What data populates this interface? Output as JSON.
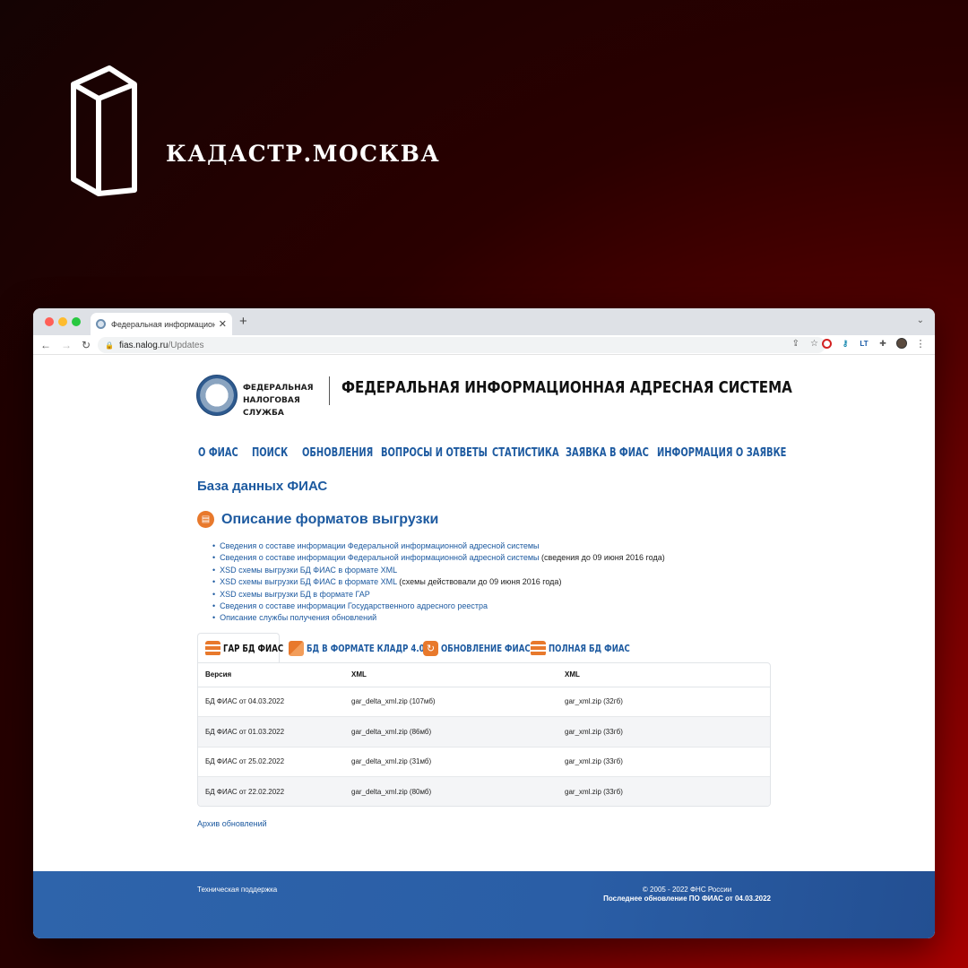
{
  "brand": {
    "name": "КАДАСТР.МОСКВА"
  },
  "browser": {
    "tab_title": "Федеральная информационн",
    "url_host": "fias.nalog.ru",
    "url_path": "/Updates"
  },
  "site": {
    "org_name": "ФЕДЕРАЛЬНАЯ НАЛОГОВАЯ СЛУЖБА",
    "title": "ФЕДЕРАЛЬНАЯ ИНФОРМАЦИОННАЯ АДРЕСНАЯ СИСТЕМА",
    "nav": [
      "О ФИАС",
      "ПОИСК",
      "ОБНОВЛЕНИЯ",
      "ВОПРОСЫ И ОТВЕТЫ",
      "СТАТИСТИКА",
      "ЗАЯВКА В ФИАС",
      "ИНФОРМАЦИЯ О ЗАЯВКЕ"
    ],
    "db_title": "База данных ФИАС",
    "section_title": "Описание форматов выгрузки",
    "links": [
      {
        "text": "Сведения о составе информации Федеральной информационной адресной системы",
        "note": ""
      },
      {
        "text": "Сведения о составе информации Федеральной информационной адресной системы",
        "note": " (сведения до 09 июня 2016 года)"
      },
      {
        "text": "XSD схемы выгрузки БД ФИАС в формате XML",
        "note": ""
      },
      {
        "text": "XSD схемы выгрузки БД ФИАС в формате XML",
        "note": " (схемы действовали до 09 июня 2016 года)"
      },
      {
        "text": "XSD схемы выгрузки БД в формате ГАР",
        "note": ""
      },
      {
        "text": "Сведения о составе информации Государственного адресного реестра",
        "note": ""
      },
      {
        "text": "Описание службы получения обновлений",
        "note": ""
      }
    ],
    "file_tabs": [
      {
        "label": "ГАР БД ФИАС",
        "icon": "server-stack-icon"
      },
      {
        "label": "БД В ФОРМАТЕ КЛАДР 4.0",
        "icon": "layers-icon"
      },
      {
        "label": "ОБНОВЛЕНИЕ ФИАС",
        "icon": "refresh-icon"
      },
      {
        "label": "ПОЛНАЯ БД ФИАС",
        "icon": "server-stack-icon"
      }
    ],
    "table": {
      "headers": [
        "Версия",
        "XML",
        "XML"
      ],
      "rows": [
        [
          "БД ФИАС от 04.03.2022",
          "gar_delta_xml.zip (107мб)",
          "gar_xml.zip (32гб)"
        ],
        [
          "БД ФИАС от 01.03.2022",
          "gar_delta_xml.zip (86мб)",
          "gar_xml.zip (33гб)"
        ],
        [
          "БД ФИАС от 25.02.2022",
          "gar_delta_xml.zip (31мб)",
          "gar_xml.zip (33гб)"
        ],
        [
          "БД ФИАС от 22.02.2022",
          "gar_delta_xml.zip (80мб)",
          "gar_xml.zip (33гб)"
        ]
      ]
    },
    "archive_link": "Архив обновлений",
    "footer": {
      "support": "Техническая поддержка",
      "copyright": "© 2005 - 2022 ФНС России",
      "last_update": "Последнее обновление ПО ФИАС от 04.03.2022"
    }
  },
  "colors": {
    "link": "#1d5aa0",
    "accent": "#e8792c",
    "footer": "#2e64ab"
  }
}
